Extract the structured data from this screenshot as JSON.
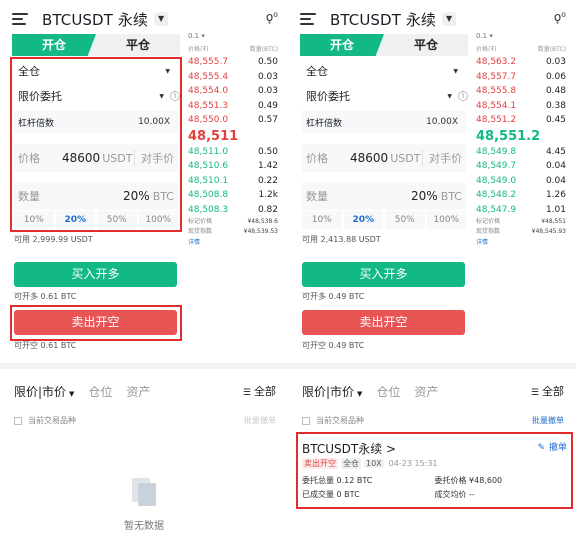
{
  "panels": {
    "left": {
      "header": {
        "pair": "BTCUSDT 永续"
      },
      "tabs": {
        "open": "开仓",
        "close": "平仓"
      },
      "form": {
        "margin_mode": "全仓",
        "order_type": "限价委托",
        "leverage_label": "杠杆倍数",
        "leverage_value": "10.00X",
        "price_label": "价格",
        "price_value": "48600",
        "price_unit": "USDT",
        "counterparty": "对手价",
        "qty_label": "数量",
        "qty_pct": "20%",
        "qty_unit": "BTC",
        "percents": [
          "10%",
          "20%",
          "50%",
          "100%"
        ],
        "active_percent": "20%"
      },
      "available": "可用 2,999.99 USDT",
      "orderbook": {
        "precision": "0.1",
        "col_price": "价格(₮)",
        "col_qty": "数量(BTC)",
        "asks": [
          {
            "p": "48,555.7",
            "q": "0.50"
          },
          {
            "p": "48,555.4",
            "q": "0.03"
          },
          {
            "p": "48,554.0",
            "q": "0.03"
          },
          {
            "p": "48,551.3",
            "q": "0.49"
          },
          {
            "p": "48,550.0",
            "q": "0.57"
          }
        ],
        "last": "48,511",
        "last_dir": "down",
        "bids": [
          {
            "p": "48,511.0",
            "q": "0.50"
          },
          {
            "p": "48,510.6",
            "q": "1.42"
          },
          {
            "p": "48,510.1",
            "q": "0.22"
          },
          {
            "p": "48,508.8",
            "q": "1.2k"
          },
          {
            "p": "48,508.3",
            "q": "0.82"
          }
        ],
        "mark_label": "标记价格",
        "mark_value": "¥48,538.6",
        "index_label": "现货指数",
        "index_value": "¥48,539.53",
        "detail": "详情"
      },
      "buy_button": "买入开多",
      "buy_avail": "可开多 0.61 BTC",
      "sell_button": "卖出开空",
      "sell_avail": "可开空 0.61 BTC",
      "orders_tabs": {
        "t1": "限价|市价",
        "t2": "仓位",
        "t3": "资产",
        "all": "全部"
      },
      "filter": {
        "label": "当前交易品种",
        "bulk": "批量撤单"
      },
      "empty": "暂无数据"
    },
    "right": {
      "header": {
        "pair": "BTCUSDT 永续"
      },
      "tabs": {
        "open": "开仓",
        "close": "平仓"
      },
      "form": {
        "margin_mode": "全仓",
        "order_type": "限价委托",
        "leverage_label": "杠杆倍数",
        "leverage_value": "10.00X",
        "price_label": "价格",
        "price_value": "48600",
        "price_unit": "USDT",
        "counterparty": "对手价",
        "qty_label": "数量",
        "qty_pct": "20%",
        "qty_unit": "BTC",
        "percents": [
          "10%",
          "20%",
          "50%",
          "100%"
        ],
        "active_percent": "20%"
      },
      "available": "可用 2,413.88 USDT",
      "orderbook": {
        "precision": "0.1",
        "col_price": "价格(₮)",
        "col_qty": "数量(BTC)",
        "asks": [
          {
            "p": "48,563.2",
            "q": "0.03"
          },
          {
            "p": "48,557.7",
            "q": "0.06"
          },
          {
            "p": "48,555.8",
            "q": "0.48"
          },
          {
            "p": "48,554.1",
            "q": "0.38"
          },
          {
            "p": "48,551.2",
            "q": "0.45"
          }
        ],
        "last": "48,551.2",
        "last_dir": "up",
        "bids": [
          {
            "p": "48,549.8",
            "q": "4.45"
          },
          {
            "p": "48,549.7",
            "q": "0.04"
          },
          {
            "p": "48,549.0",
            "q": "0.04"
          },
          {
            "p": "48,548.2",
            "q": "1.26"
          },
          {
            "p": "48,547.9",
            "q": "1.01"
          }
        ],
        "mark_label": "标记价格",
        "mark_value": "¥48,551",
        "index_label": "现货指数",
        "index_value": "¥48,545.93",
        "detail": "详情"
      },
      "buy_button": "买入开多",
      "buy_avail": "可开多 0.49 BTC",
      "sell_button": "卖出开空",
      "sell_avail": "可开空 0.49 BTC",
      "orders_tabs": {
        "t1": "限价|市价",
        "t2": "仓位",
        "t3": "资产",
        "all": "全部"
      },
      "filter": {
        "label": "当前交易品种",
        "bulk": "批量撤单"
      },
      "order": {
        "title": "BTCUSDT永续 >",
        "cancel": "撤单",
        "side": "卖出开空",
        "mode": "全仓",
        "leverage": "10X",
        "time": "04-23 15:31",
        "total_label": "委托总量 0.12 BTC",
        "price_label": "委托价格 ¥48,600",
        "filled_label": "已成交量 0 BTC",
        "avg_label": "成交均价 --"
      }
    }
  },
  "colors": {
    "buy": "#12b886",
    "sell": "#e85353",
    "highlight": "#e12d2d",
    "link": "#1f6fd1"
  }
}
